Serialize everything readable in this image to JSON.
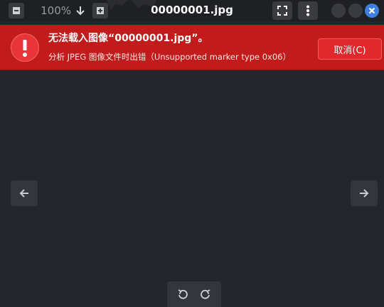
{
  "header": {
    "zoom_level": "100%",
    "title": "00000001.jpg"
  },
  "error": {
    "title": "无法载入图像“00000001.jpg”。",
    "message": "分析 JPEG 图像文件时出错（Unsupported marker type 0x06）",
    "cancel_label": "取消(C)"
  },
  "colors": {
    "banner": "#c11b1b",
    "close_button": "#3d7fe0",
    "background": "#25262d"
  }
}
